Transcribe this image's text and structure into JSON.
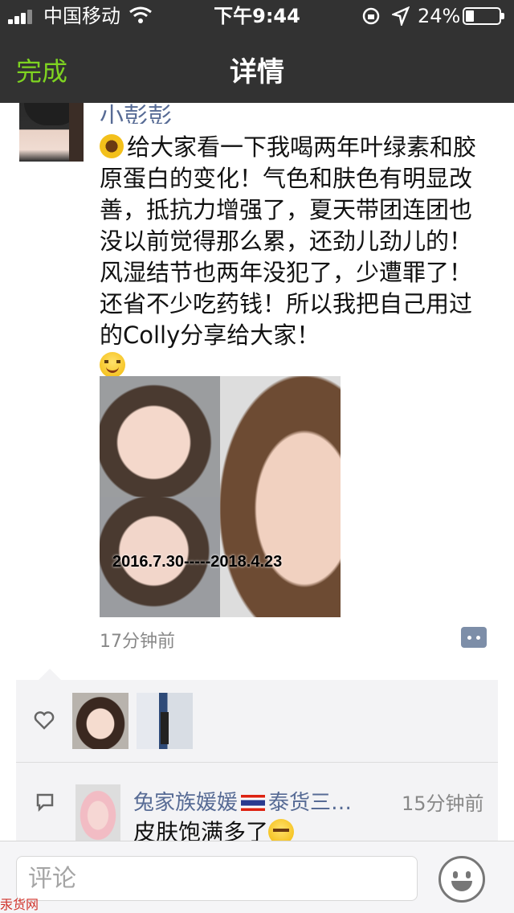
{
  "status_bar": {
    "carrier": "中国移动",
    "time": "下午9:44",
    "battery": "24%",
    "battery_level": 0.24
  },
  "nav": {
    "done_label": "完成",
    "title": "详情"
  },
  "post": {
    "username": "小彭彭",
    "text": "给大家看一下我喝两年叶绿素和胶原蛋白的变化！气色和肤色有明显改善，抵抗力增强了，夏天带团连团也没以前觉得那么累，还劲儿劲儿的！风湿结节也两年没犯了，少遭罪了！还省不少吃药钱！所以我把自己用过的Colly分享给大家！",
    "leading_emoji": "sunflower-emoji",
    "trailing_emoji": "smile-emoji",
    "photo_caption": "2016.7.30-----2018.4.23",
    "time": "17分钟前"
  },
  "comments": [
    {
      "author": "兔家族媛媛",
      "author_suffix": "泰货三…",
      "time": "15分钟前",
      "text": "皮肤饱满多了"
    }
  ],
  "input": {
    "placeholder": "评论"
  },
  "watermark": "汞货网"
}
